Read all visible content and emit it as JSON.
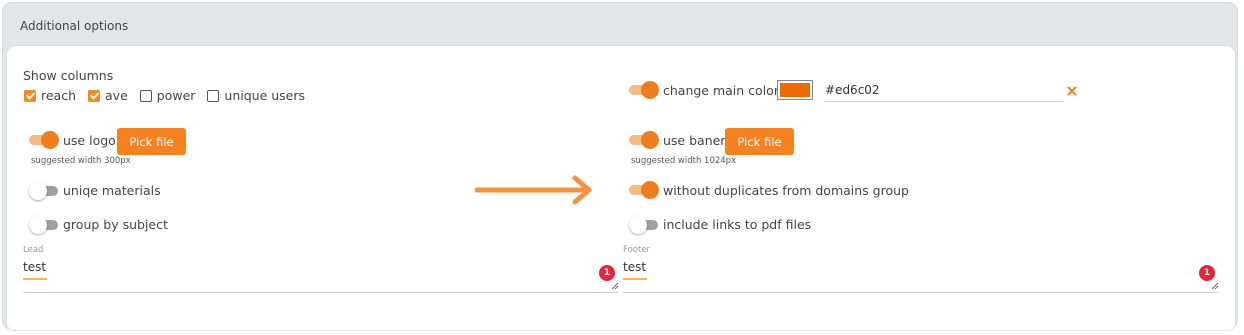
{
  "panel": {
    "title": "Additional options"
  },
  "columns": {
    "title": "Show columns",
    "items": [
      {
        "label": "reach",
        "checked": true
      },
      {
        "label": "ave",
        "checked": true
      },
      {
        "label": "power",
        "checked": false
      },
      {
        "label": "unique users",
        "checked": false
      }
    ]
  },
  "left": {
    "use_logo": {
      "label": "use logo",
      "on": true,
      "button": "Pick file",
      "hint": "suggested width 300px"
    },
    "uniqe_materials": {
      "label": "uniqe materials",
      "on": false
    },
    "group_by_subject": {
      "label": "group by subject",
      "on": false
    },
    "lead": {
      "label": "Lead",
      "value": "test",
      "badge": "1"
    }
  },
  "right": {
    "change_main_color": {
      "label": "change main color",
      "on": true,
      "color": "#ed6c02",
      "value": "#ed6c02"
    },
    "use_baner": {
      "label": "use baner",
      "on": true,
      "button": "Pick file",
      "hint": "suggested width 1024px"
    },
    "without_duplicates": {
      "label": "without duplicates from domains group",
      "on": true
    },
    "include_links": {
      "label": "include links to pdf files",
      "on": false
    },
    "footer": {
      "label": "Footer",
      "value": "test",
      "badge": "1"
    }
  },
  "colors": {
    "accent": "#f58220",
    "arrow": "#f5923e",
    "badge": "#e8233b",
    "clear": "#f58220"
  }
}
